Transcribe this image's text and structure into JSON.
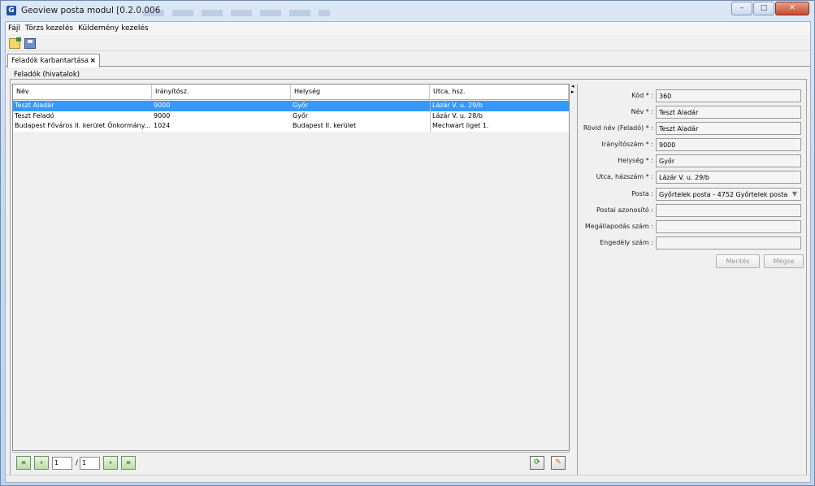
{
  "window": {
    "title": "Geoview   posta modul [0.2.0.006",
    "icon": "app-icon",
    "controls": {
      "minimize": "–",
      "maximize": "□",
      "close": "✕"
    }
  },
  "menu": [
    "Fájl",
    "Törzs kezelés",
    "Küldemény kezelés"
  ],
  "toolbar": {
    "icons": [
      "open-icon",
      "save-icon"
    ]
  },
  "tab": {
    "label": "Feladók karbantartása",
    "close": "×"
  },
  "panel_title": "Feladók (hivatalok)",
  "table": {
    "columns": [
      "Név",
      "Irányítósz.",
      "Helység",
      "Utca, hsz."
    ],
    "rows": [
      {
        "name": "Teszt Aladár",
        "zip": "9000",
        "city": "Győr",
        "street": "Lázár V. u. 29/b",
        "selected": true
      },
      {
        "name": "Teszt Feladó",
        "zip": "9000",
        "city": "Győr",
        "street": "Lázár V. u. 28/b",
        "selected": false
      },
      {
        "name": "Budapest Főváros II. kerület Önkormány...",
        "zip": "1024",
        "city": "Budapest II. kerület",
        "street": "Mechwart liget 1.",
        "selected": false
      }
    ]
  },
  "pager": {
    "first": "«",
    "prev": "‹",
    "page": "1",
    "slash": "/",
    "total": "1",
    "next": "›",
    "last": "»",
    "refresh": "⟳",
    "edit": "✎"
  },
  "form": {
    "fields": [
      {
        "label": "Kód * :",
        "value": "360"
      },
      {
        "label": "Név * :",
        "value": "Teszt Aladár"
      },
      {
        "label": "Rövid név (Feladó) * :",
        "value": "Teszt Aladár"
      },
      {
        "label": "Irányítószám * :",
        "value": "9000"
      },
      {
        "label": "Helység * :",
        "value": "Győr"
      },
      {
        "label": "Utca, házszám * :",
        "value": "Lázár V. u. 29/b"
      },
      {
        "label": "Posta :",
        "value": "Győrtelek posta - 4752 Győrtelek posta"
      },
      {
        "label": "Postai azonosító :",
        "value": ""
      },
      {
        "label": "Megállapodás szám :",
        "value": ""
      },
      {
        "label": "Engedély szám :",
        "value": ""
      }
    ],
    "save_label": "Mentés",
    "cancel_label": "Mégse"
  }
}
